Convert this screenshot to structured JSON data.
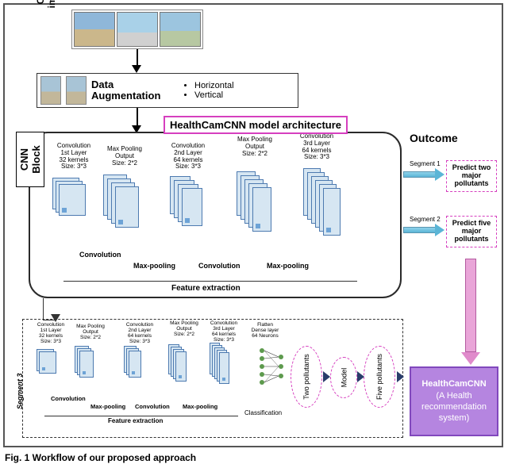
{
  "captured_label": "Captured image data",
  "augmentation": {
    "title": "Data Augmentation",
    "items": [
      "Horizontal",
      "Vertical"
    ]
  },
  "model_header": "HealthCamCNN model architecture",
  "cnn_block_label": "CNN Block",
  "outcome_label": "Outcome",
  "cnn_layers": {
    "conv1": "Convolution\n1st Layer\n32 kernels\nSize: 3*3",
    "mp1": "Max Pooling\nOutput\nSize: 2*2",
    "conv2": "Convolution\n2nd Layer\n64 kernels\nSize: 3*3",
    "mp2": "Max Pooling\nOutput\nSize: 2*2",
    "conv3": "Convolution\n3rd Layer\n64 kernels\nSize: 3*3",
    "op_conv": "Convolution",
    "op_mp": "Max-pooling",
    "feature_extraction": "Feature extraction"
  },
  "segments": {
    "seg1": "Segment 1",
    "seg2": "Segment 2",
    "seg3": "Segment 3"
  },
  "outcome_boxes": {
    "two": "Predict two major pollutants",
    "five": "Predict five major pollutants"
  },
  "seg3_layers": {
    "conv1": "Convolution\n1st Layer\n32 kernels\nSize: 3*3",
    "mp1": "Max Pooling\nOutput\nSize: 2*2",
    "conv2": "Convolution\n2nd Layer\n64 kernels\nSize: 3*3",
    "mp2": "Max Pooling\nOutput\nSize: 2*2",
    "conv3": "Convolution\n3rd Layer\n64 kernels\nSize: 3*3",
    "flatten": "Flatten\nDense layer\n64 Neurons",
    "classification": "Classification"
  },
  "ovals": {
    "two": "Two pollutants",
    "model": "Model",
    "five": "Five pollutants"
  },
  "final_box": {
    "title": "HealthCamCNN",
    "subtitle": "(A Health recommendation system)"
  },
  "caption": "Fig. 1  Workflow of our proposed approach"
}
